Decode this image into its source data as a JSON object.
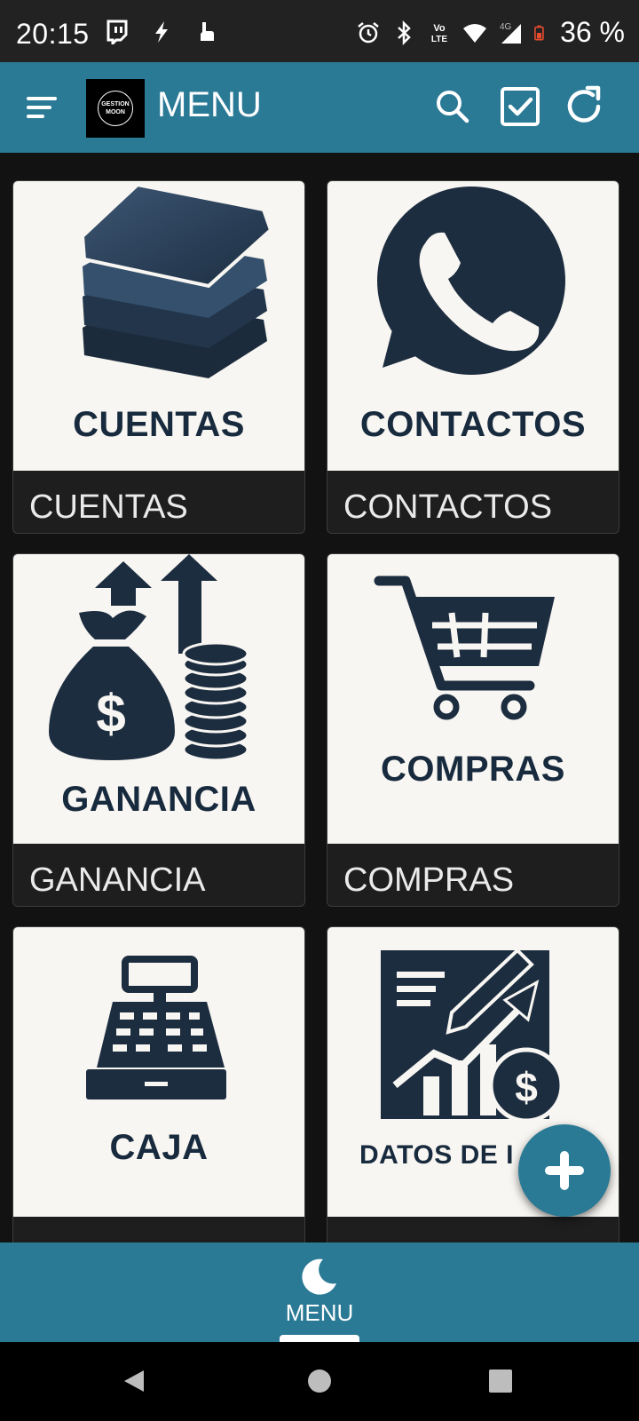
{
  "status_bar": {
    "time": "20:15",
    "battery": "36 %",
    "left_icons": [
      "twitch-icon",
      "bolt-icon",
      "hand-icon"
    ],
    "right_icons": [
      "alarm-icon",
      "bluetooth-icon",
      "volte-icon",
      "wifi-icon",
      "signal-4g-icon",
      "battery-icon"
    ],
    "volte_top": "Vo",
    "volte_bottom": "LTE",
    "network": "4G"
  },
  "app_bar": {
    "title": "MENU",
    "logo_line1": "GESTION",
    "logo_line2": "MOON",
    "actions": [
      "search-icon",
      "check-square-icon",
      "refresh-icon"
    ],
    "background": "#2a7a96"
  },
  "cards": [
    {
      "image_text": "CUENTAS",
      "label": "CUENTAS",
      "icon": "stack-icon"
    },
    {
      "image_text": "CONTACTOS",
      "label": "CONTACTOS",
      "icon": "whatsapp-icon"
    },
    {
      "image_text": "GANANCIA",
      "label": "GANANCIA",
      "icon": "money-bag-icon"
    },
    {
      "image_text": "COMPRAS",
      "label": "COMPRAS",
      "icon": "shopping-cart-icon"
    },
    {
      "image_text": "CAJA",
      "label": "",
      "icon": "cash-register-icon"
    },
    {
      "image_text": "DATOS DE I",
      "label": "",
      "icon": "report-chart-icon"
    }
  ],
  "fab": {
    "icon": "plus-icon"
  },
  "bottom_nav": {
    "label": "MENU",
    "icon": "moon-icon"
  },
  "system_nav": [
    "back-icon",
    "home-icon",
    "recents-icon"
  ],
  "colors": {
    "card_image_bg": "#f8f6f2",
    "icon_navy": "#182b3e",
    "accent": "#2a7a96"
  }
}
